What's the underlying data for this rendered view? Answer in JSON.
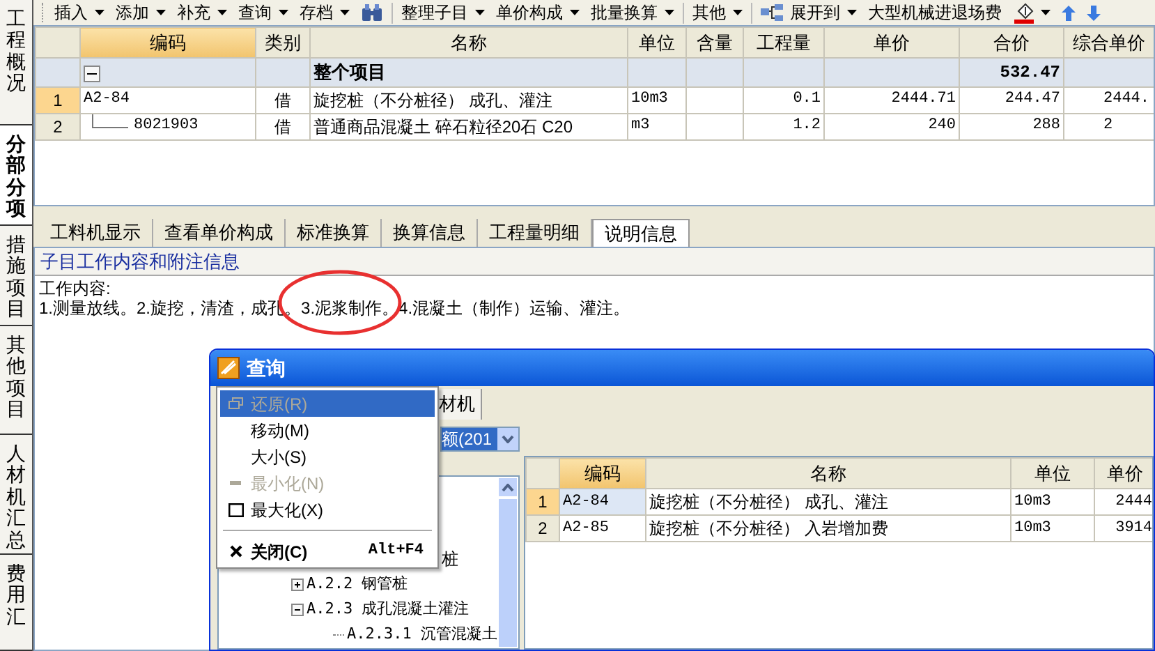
{
  "side_tabs": [
    {
      "label": "工程概况",
      "selected": false
    },
    {
      "label": "分部分项",
      "selected": true
    },
    {
      "label": "措施项目",
      "selected": false
    },
    {
      "label": "其他项目",
      "selected": false
    },
    {
      "label": "人材机汇总",
      "selected": false
    },
    {
      "label": "费用汇",
      "selected": false
    }
  ],
  "toolbar": [
    {
      "kind": "menu",
      "label": "插入"
    },
    {
      "kind": "menu",
      "label": "添加"
    },
    {
      "kind": "menu",
      "label": "补充"
    },
    {
      "kind": "menu",
      "label": "查询"
    },
    {
      "kind": "menu",
      "label": "存档"
    },
    {
      "kind": "find"
    },
    {
      "kind": "sep"
    },
    {
      "kind": "menu",
      "label": "整理子目"
    },
    {
      "kind": "menu",
      "label": "单价构成"
    },
    {
      "kind": "menu",
      "label": "批量换算"
    },
    {
      "kind": "sep"
    },
    {
      "kind": "menu",
      "label": "其他"
    },
    {
      "kind": "sep"
    },
    {
      "kind": "expand",
      "label": "展开到"
    },
    {
      "kind": "text",
      "label": "大型机械进退场费"
    },
    {
      "kind": "paint"
    },
    {
      "kind": "up"
    },
    {
      "kind": "down"
    }
  ],
  "table": {
    "columns": [
      {
        "label": "编码",
        "selected": true
      },
      {
        "label": "类别",
        "selected": false
      },
      {
        "label": "名称",
        "selected": false
      },
      {
        "label": "单位",
        "selected": false
      },
      {
        "label": "含量",
        "selected": false
      },
      {
        "label": "工程量",
        "selected": false
      },
      {
        "label": "单价",
        "selected": false
      },
      {
        "label": "合价",
        "selected": false
      },
      {
        "label": "综合单价",
        "selected": false
      }
    ],
    "rows": [
      {
        "kind": "group",
        "expanded": true,
        "name": "整个项目",
        "total": "532.47"
      },
      {
        "kind": "item",
        "selected": true,
        "number": "1",
        "cells": [
          "A2-84",
          "借",
          "旋挖桩（不分桩径） 成孔、灌注",
          "10m3",
          "",
          "0.1",
          "2444.71",
          "244.47",
          "2444."
        ]
      },
      {
        "kind": "child",
        "selected": false,
        "number": "2",
        "cells": [
          "8021903",
          "借",
          "普通商品混凝土 碎石粒径20石 C20",
          "m3",
          "",
          "1.2",
          "240",
          "288",
          "2"
        ]
      }
    ]
  },
  "bottom_tabs": [
    {
      "label": "工料机显示",
      "selected": false
    },
    {
      "label": "查看单价构成",
      "selected": false
    },
    {
      "label": "标准换算",
      "selected": false
    },
    {
      "label": "换算信息",
      "selected": false
    },
    {
      "label": "工程量明细",
      "selected": false
    },
    {
      "label": "说明信息",
      "selected": true
    }
  ],
  "info": {
    "caption": "子目工作内容和附注信息",
    "lines": [
      "工作内容:",
      "1.测量放线。2.旋挖，清渣，成孔。3.泥浆制作。4.混凝土（制作）运输、灌注。"
    ],
    "circled": true
  },
  "dialog": {
    "title": "查询",
    "tab": "材机",
    "combo_value": "额(201",
    "tree": [
      {
        "kind": "partial",
        "label": "桩"
      },
      {
        "kind": "node",
        "label": "A.2.2 钢管桩",
        "expanded": false
      },
      {
        "kind": "node",
        "label": "A.2.3 成孔混凝土灌注",
        "expanded": true,
        "children": [
          {
            "kind": "leaf",
            "label": "A.2.3.1 沉管混凝土"
          }
        ]
      }
    ],
    "table": {
      "columns": [
        "编码",
        "名称",
        "单位",
        "单价"
      ],
      "rows": [
        {
          "number": "1",
          "selected": true,
          "cells": [
            "A2-84",
            "旋挖桩（不分桩径） 成孔、灌注",
            "10m3",
            "2444"
          ]
        },
        {
          "number": "2",
          "selected": false,
          "cells": [
            "A2-85",
            "旋挖桩（不分桩径） 入岩增加费",
            "10m3",
            "3914"
          ]
        }
      ]
    },
    "system_menu": [
      {
        "kind": "restore",
        "label": "还原(R)",
        "selected": true,
        "disabled": true
      },
      {
        "kind": "none",
        "label": "移动(M)",
        "selected": false,
        "disabled": false
      },
      {
        "kind": "none",
        "label": "大小(S)",
        "selected": false,
        "disabled": false
      },
      {
        "kind": "minimize",
        "label": "最小化(N)",
        "selected": false,
        "disabled": true
      },
      {
        "kind": "maximize",
        "label": "最大化(X)",
        "selected": false,
        "disabled": false
      },
      {
        "kind": "sep"
      },
      {
        "kind": "close",
        "label": "关闭(C)",
        "shortcut": "Alt+F4",
        "selected": false,
        "disabled": false
      }
    ]
  }
}
